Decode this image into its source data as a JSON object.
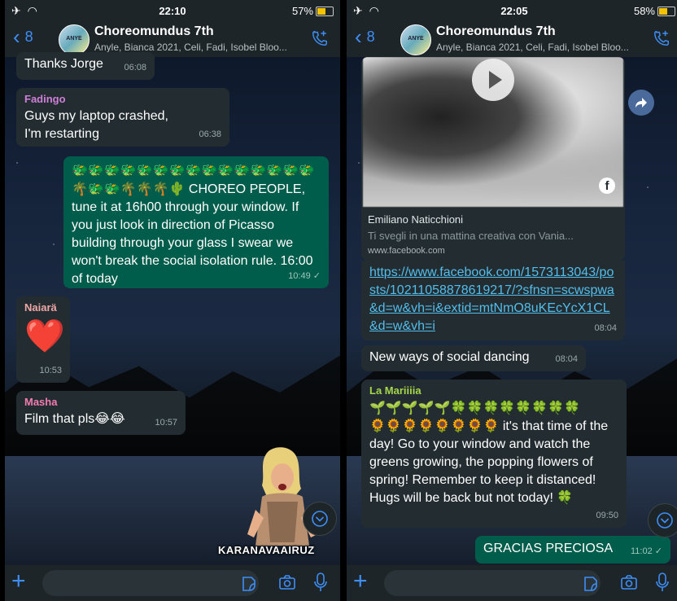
{
  "left": {
    "status": {
      "time": "22:10",
      "battery": "57%",
      "battery_level": 0.57
    },
    "header": {
      "back_count": "8",
      "title": "Choreomundus 7th",
      "subtitle": "Anyle, Bianca 2021, Celi, Fadi, Isobel Bloo...",
      "avatar_text": "ANYE"
    },
    "messages": [
      {
        "text": "Thanks Jorge",
        "time": "06:08"
      },
      {
        "sender": "Fadingo",
        "sender_color": "#d07fd8",
        "text": "Guys my laptop crashed, I'm restarting",
        "time": "06:38"
      },
      {
        "emoji_line": "🐲🐲🐲🐲🐲🐲🐲🐲🐲🐲🐲🐲🐲🐲🐲🌴🐲🐲🌴🌴🌴🌵",
        "text": " CHOREO PEOPLE, tune it at 16h00 through your window. If you just look in direction of Picasso building through your glass I swear we won't break the social isolation rule. 16:00 of today",
        "time": "10:49"
      },
      {
        "sender": "Naiarä",
        "sender_color": "#f0a6a6",
        "emoji": "❤️",
        "time": "10:53"
      },
      {
        "sender": "Masha",
        "sender_color": "#f27bb0",
        "text": "Film that pls😂😂",
        "time": "10:57"
      }
    ],
    "sticker_caption": "KARANAVAAIRUZ"
  },
  "right": {
    "status": {
      "time": "22:05",
      "battery": "58%",
      "battery_level": 0.58
    },
    "header": {
      "back_count": "8",
      "title": "Choreomundus 7th",
      "subtitle": "Anyle, Bianca 2021, Celi, Fadi, Isobel Bloo...",
      "avatar_text": "ANYE"
    },
    "preview": {
      "title": "Emiliano Naticchioni",
      "description": "Ti svegli in una mattina creativa con Vania...",
      "url": "www.facebook.com"
    },
    "link_message": {
      "link": "https://www.facebook.com/1573113043/posts/10211058878619217/?sfnsn=scwspwa&d=w&vh=i&extid=mtNmO8uKEcYcX1CL&d=w&vh=i",
      "time": "08:04"
    },
    "message_dancing": {
      "text": "New ways of social dancing",
      "time": "08:04"
    },
    "message_mariiia": {
      "sender": "La Mariiiia",
      "sender_color": "#a5d64b",
      "emoji_line1": "🌱🌱🌱🌱🌱🍀🍀🍀🍀🍀🍀🍀🍀",
      "emoji_line2": "🌻🌻🌻🌻🌻🌻🌻🌻",
      "text": " it's that time of the day! Go to your window and watch the greens growing, the popping flowers of spring! Remember to keep it distanced! Hugs will be back but not today! 🍀",
      "time": "09:50"
    },
    "message_gracias": {
      "text": "GRACIAS PRECIOSA",
      "time": "11:02"
    }
  },
  "colors": {
    "accent": "#3e8ef7",
    "incoming": "#232d31",
    "outgoing": "#005c4b",
    "bar": "#1e2528"
  }
}
